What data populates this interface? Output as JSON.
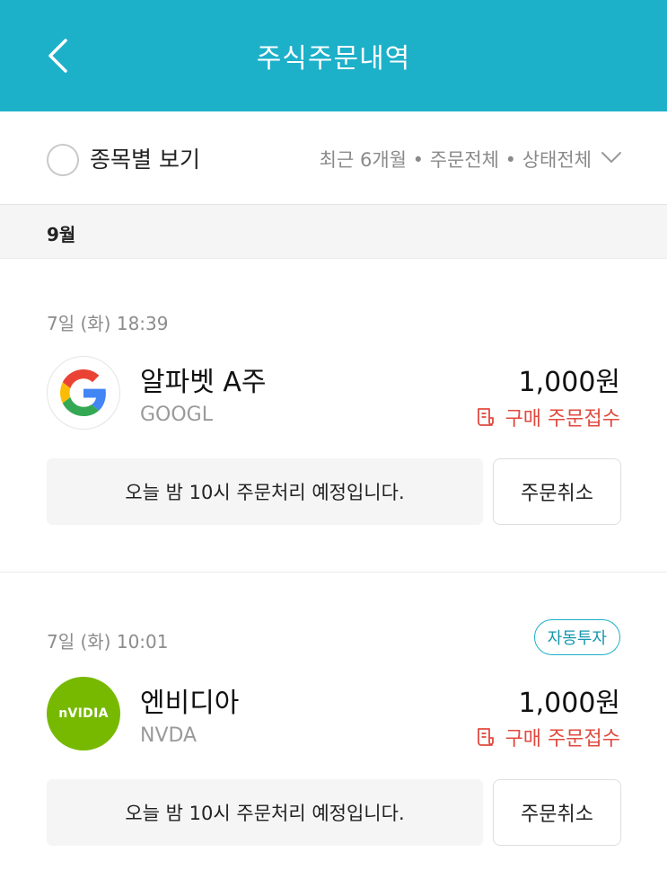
{
  "header": {
    "title": "주식주문내역",
    "back_icon": "chevron-left-icon"
  },
  "filter": {
    "view_by_stock_label": "종목별 보기",
    "summary": "최근 6개월 • 주문전체 • 상태전체",
    "dropdown_icon": "chevron-down-icon"
  },
  "month": "9월",
  "colors": {
    "accent": "#1db0c9",
    "status_red": "#e04a3f",
    "nvidia_green": "#76b900"
  },
  "orders": [
    {
      "datetime": "7일 (화) 18:39",
      "badge": "",
      "logo_icon": "google-logo-icon",
      "name": "알파벳 A주",
      "ticker": "GOOGL",
      "amount": "1,000원",
      "status": "구매 주문접수",
      "notice": "오늘 밤 10시 주문처리 예정입니다.",
      "cancel_label": "주문취소"
    },
    {
      "datetime": "7일 (화) 10:01",
      "badge": "자동투자",
      "logo_icon": "nvidia-logo-icon",
      "logo_text": "nVIDIA",
      "name": "엔비디아",
      "ticker": "NVDA",
      "amount": "1,000원",
      "status": "구매 주문접수",
      "notice": "오늘 밤 10시 주문처리 예정입니다.",
      "cancel_label": "주문취소"
    }
  ]
}
